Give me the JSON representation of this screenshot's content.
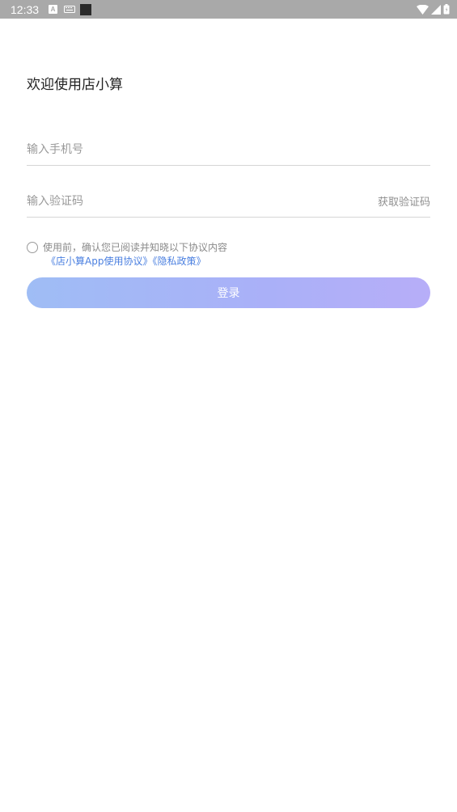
{
  "status_bar": {
    "time": "12:33",
    "a_icon_letter": "A"
  },
  "title": "欢迎使用店小算",
  "phone_input": {
    "placeholder": "输入手机号",
    "value": ""
  },
  "code_input": {
    "placeholder": "输入验证码",
    "value": ""
  },
  "get_code_label": "获取验证码",
  "agreement": {
    "text": "使用前，确认您已阅读并知晓以下协议内容",
    "user_agreement_link": "《店小算App使用协议》",
    "privacy_link": "《隐私政策》",
    "checked": false
  },
  "login_label": "登录",
  "colors": {
    "link": "#4a7fe0",
    "button_gradient_start": "#9fbdf5",
    "button_gradient_end": "#b7aef8",
    "status_bar": "#a9a9a9"
  }
}
